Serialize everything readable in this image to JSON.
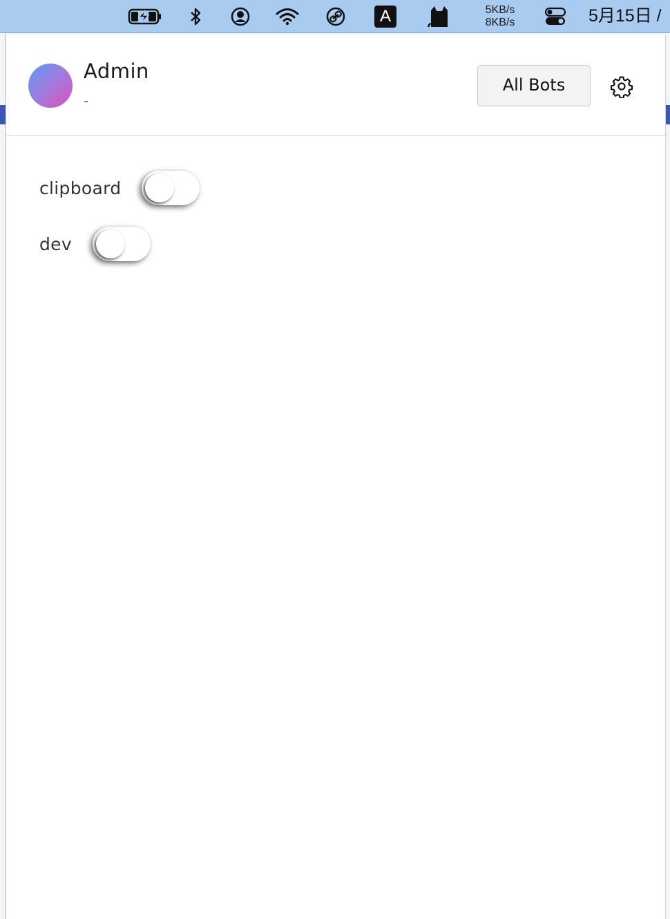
{
  "menubar": {
    "icons": [
      "battery-charging-icon",
      "bluetooth-icon",
      "user-account-icon",
      "wifi-icon",
      "link-icon",
      "input-source-icon",
      "cat-icon",
      "control-center-icon"
    ],
    "input_source_letter": "A",
    "net_up": "5KB/s",
    "net_down": "8KB/s",
    "clock": "5月15日 /"
  },
  "header": {
    "username": "Admin",
    "subtitle": "-",
    "all_bots_label": "All Bots",
    "avatar_gradient": [
      "#5b9bf0",
      "#e04fbf"
    ]
  },
  "bots": [
    {
      "name": "clipboard",
      "enabled": false
    },
    {
      "name": "dev",
      "enabled": false
    }
  ],
  "colors": {
    "menubar_bg": "#a9cbef",
    "panel_bg": "#ffffff",
    "accent_blue": "#3b56b5"
  }
}
